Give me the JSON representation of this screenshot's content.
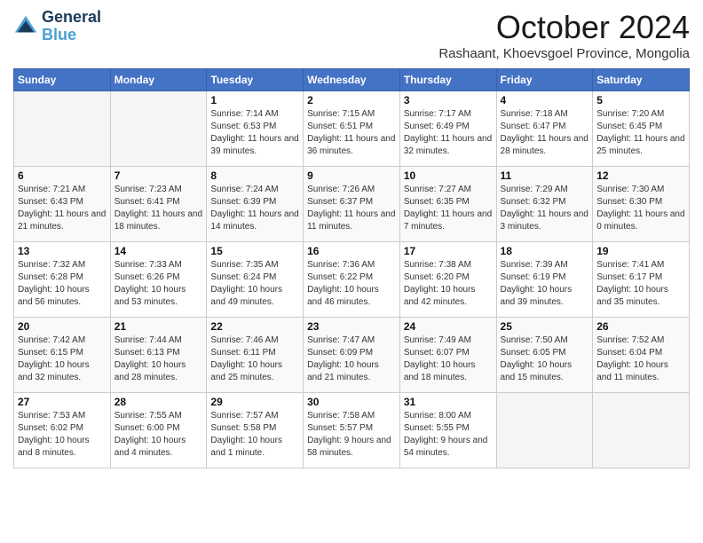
{
  "header": {
    "logo_line1": "General",
    "logo_line2": "Blue",
    "month_title": "October 2024",
    "location": "Rashaant, Khoevsgoel Province, Mongolia"
  },
  "weekdays": [
    "Sunday",
    "Monday",
    "Tuesday",
    "Wednesday",
    "Thursday",
    "Friday",
    "Saturday"
  ],
  "weeks": [
    [
      {
        "day": "",
        "info": ""
      },
      {
        "day": "",
        "info": ""
      },
      {
        "day": "1",
        "info": "Sunrise: 7:14 AM\nSunset: 6:53 PM\nDaylight: 11 hours and 39 minutes."
      },
      {
        "day": "2",
        "info": "Sunrise: 7:15 AM\nSunset: 6:51 PM\nDaylight: 11 hours and 36 minutes."
      },
      {
        "day": "3",
        "info": "Sunrise: 7:17 AM\nSunset: 6:49 PM\nDaylight: 11 hours and 32 minutes."
      },
      {
        "day": "4",
        "info": "Sunrise: 7:18 AM\nSunset: 6:47 PM\nDaylight: 11 hours and 28 minutes."
      },
      {
        "day": "5",
        "info": "Sunrise: 7:20 AM\nSunset: 6:45 PM\nDaylight: 11 hours and 25 minutes."
      }
    ],
    [
      {
        "day": "6",
        "info": "Sunrise: 7:21 AM\nSunset: 6:43 PM\nDaylight: 11 hours and 21 minutes."
      },
      {
        "day": "7",
        "info": "Sunrise: 7:23 AM\nSunset: 6:41 PM\nDaylight: 11 hours and 18 minutes."
      },
      {
        "day": "8",
        "info": "Sunrise: 7:24 AM\nSunset: 6:39 PM\nDaylight: 11 hours and 14 minutes."
      },
      {
        "day": "9",
        "info": "Sunrise: 7:26 AM\nSunset: 6:37 PM\nDaylight: 11 hours and 11 minutes."
      },
      {
        "day": "10",
        "info": "Sunrise: 7:27 AM\nSunset: 6:35 PM\nDaylight: 11 hours and 7 minutes."
      },
      {
        "day": "11",
        "info": "Sunrise: 7:29 AM\nSunset: 6:32 PM\nDaylight: 11 hours and 3 minutes."
      },
      {
        "day": "12",
        "info": "Sunrise: 7:30 AM\nSunset: 6:30 PM\nDaylight: 11 hours and 0 minutes."
      }
    ],
    [
      {
        "day": "13",
        "info": "Sunrise: 7:32 AM\nSunset: 6:28 PM\nDaylight: 10 hours and 56 minutes."
      },
      {
        "day": "14",
        "info": "Sunrise: 7:33 AM\nSunset: 6:26 PM\nDaylight: 10 hours and 53 minutes."
      },
      {
        "day": "15",
        "info": "Sunrise: 7:35 AM\nSunset: 6:24 PM\nDaylight: 10 hours and 49 minutes."
      },
      {
        "day": "16",
        "info": "Sunrise: 7:36 AM\nSunset: 6:22 PM\nDaylight: 10 hours and 46 minutes."
      },
      {
        "day": "17",
        "info": "Sunrise: 7:38 AM\nSunset: 6:20 PM\nDaylight: 10 hours and 42 minutes."
      },
      {
        "day": "18",
        "info": "Sunrise: 7:39 AM\nSunset: 6:19 PM\nDaylight: 10 hours and 39 minutes."
      },
      {
        "day": "19",
        "info": "Sunrise: 7:41 AM\nSunset: 6:17 PM\nDaylight: 10 hours and 35 minutes."
      }
    ],
    [
      {
        "day": "20",
        "info": "Sunrise: 7:42 AM\nSunset: 6:15 PM\nDaylight: 10 hours and 32 minutes."
      },
      {
        "day": "21",
        "info": "Sunrise: 7:44 AM\nSunset: 6:13 PM\nDaylight: 10 hours and 28 minutes."
      },
      {
        "day": "22",
        "info": "Sunrise: 7:46 AM\nSunset: 6:11 PM\nDaylight: 10 hours and 25 minutes."
      },
      {
        "day": "23",
        "info": "Sunrise: 7:47 AM\nSunset: 6:09 PM\nDaylight: 10 hours and 21 minutes."
      },
      {
        "day": "24",
        "info": "Sunrise: 7:49 AM\nSunset: 6:07 PM\nDaylight: 10 hours and 18 minutes."
      },
      {
        "day": "25",
        "info": "Sunrise: 7:50 AM\nSunset: 6:05 PM\nDaylight: 10 hours and 15 minutes."
      },
      {
        "day": "26",
        "info": "Sunrise: 7:52 AM\nSunset: 6:04 PM\nDaylight: 10 hours and 11 minutes."
      }
    ],
    [
      {
        "day": "27",
        "info": "Sunrise: 7:53 AM\nSunset: 6:02 PM\nDaylight: 10 hours and 8 minutes."
      },
      {
        "day": "28",
        "info": "Sunrise: 7:55 AM\nSunset: 6:00 PM\nDaylight: 10 hours and 4 minutes."
      },
      {
        "day": "29",
        "info": "Sunrise: 7:57 AM\nSunset: 5:58 PM\nDaylight: 10 hours and 1 minute."
      },
      {
        "day": "30",
        "info": "Sunrise: 7:58 AM\nSunset: 5:57 PM\nDaylight: 9 hours and 58 minutes."
      },
      {
        "day": "31",
        "info": "Sunrise: 8:00 AM\nSunset: 5:55 PM\nDaylight: 9 hours and 54 minutes."
      },
      {
        "day": "",
        "info": ""
      },
      {
        "day": "",
        "info": ""
      }
    ]
  ]
}
